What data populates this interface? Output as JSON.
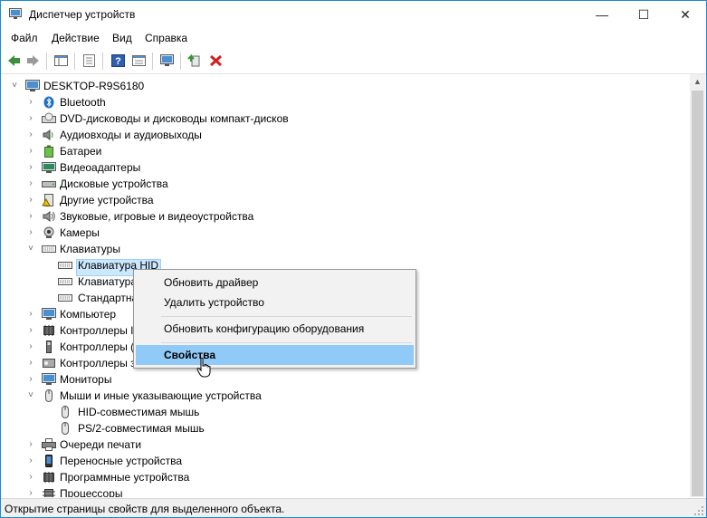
{
  "window": {
    "title": "Диспетчер устройств",
    "controls": {
      "minimize": "—",
      "maximize": "☐",
      "close": "✕"
    }
  },
  "menu": [
    "Файл",
    "Действие",
    "Вид",
    "Справка"
  ],
  "toolbar": {
    "icons": [
      "back-arrow-icon",
      "forward-arrow-icon",
      "show-hide-tree-icon",
      "properties-icon",
      "help-icon",
      "resource-view-icon",
      "monitor-scan-icon",
      "update-driver-icon",
      "uninstall-x-icon"
    ]
  },
  "tree": {
    "root": "DESKTOP-R9S6180",
    "items": [
      {
        "label": "Bluetooth",
        "icon": "bluetooth-icon"
      },
      {
        "label": "DVD-дисководы и дисководы компакт-дисков",
        "icon": "dvd-drive-icon"
      },
      {
        "label": "Аудиовходы и аудиовыходы",
        "icon": "speaker-icon"
      },
      {
        "label": "Батареи",
        "icon": "battery-icon"
      },
      {
        "label": "Видеоадаптеры",
        "icon": "display-adapter-icon"
      },
      {
        "label": "Дисковые устройства",
        "icon": "disk-drive-icon"
      },
      {
        "label": "Другие устройства",
        "icon": "unknown-device-icon"
      },
      {
        "label": "Звуковые, игровые и видеоустройства",
        "icon": "sound-icon"
      },
      {
        "label": "Камеры",
        "icon": "camera-icon"
      },
      {
        "label": "Клавиатуры",
        "icon": "keyboard-icon"
      },
      {
        "label": "Клавиатура HID",
        "icon": "keyboard-icon"
      },
      {
        "label": "Клавиатура",
        "icon": "keyboard-icon"
      },
      {
        "label": "Стандартна",
        "icon": "keyboard-icon"
      },
      {
        "label": "Компьютер",
        "icon": "computer-icon"
      },
      {
        "label": "Контроллеры I",
        "icon": "controller-icon"
      },
      {
        "label": "Контроллеры (",
        "icon": "usb-controller-icon"
      },
      {
        "label": "Контроллеры з",
        "icon": "storage-controller-icon"
      },
      {
        "label": "Мониторы",
        "icon": "monitor-icon"
      },
      {
        "label": "Мыши и иные указывающие устройства",
        "icon": "mouse-icon"
      },
      {
        "label": "HID-совместимая мышь",
        "icon": "mouse-icon"
      },
      {
        "label": "PS/2-совместимая мышь",
        "icon": "mouse-icon"
      },
      {
        "label": "Очереди печати",
        "icon": "printer-icon"
      },
      {
        "label": "Переносные устройства",
        "icon": "portable-device-icon"
      },
      {
        "label": "Программные устройства",
        "icon": "software-device-icon"
      },
      {
        "label": "Процессоры",
        "icon": "processor-icon"
      }
    ]
  },
  "context_menu": {
    "items": [
      "Обновить драйвер",
      "Удалить устройство",
      "Обновить конфигурацию оборудования",
      "Свойства"
    ]
  },
  "status": "Открытие страницы свойств для выделенного объекта.",
  "colors": {
    "accent": "#1a8ad4",
    "selection": "#cce8ff",
    "menu_highlight": "#91c9f7",
    "uninstall_red": "#d21f1f"
  }
}
